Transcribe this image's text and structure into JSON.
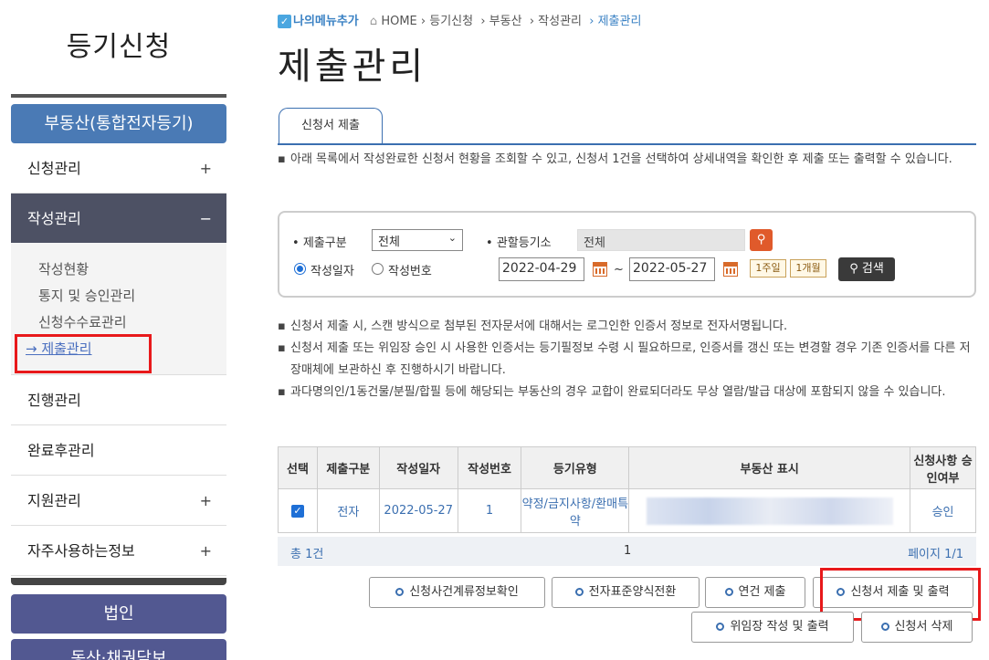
{
  "sidebar": {
    "title": "등기신청",
    "category_realestate": "부동산(통합전자등기)",
    "items": [
      {
        "label": "신청관리",
        "sign": "+"
      },
      {
        "label": "작성관리",
        "sign": "−"
      },
      {
        "label": "진행관리",
        "sign": ""
      },
      {
        "label": "완료후관리",
        "sign": ""
      },
      {
        "label": "지원관리",
        "sign": "+"
      },
      {
        "label": "자주사용하는정보",
        "sign": "+"
      }
    ],
    "submenu": [
      "작성현황",
      "통지 및 승인관리",
      "신청수수료관리",
      "→ 제출관리"
    ],
    "category_corp": "법인",
    "category_movable": "동산·채권담보"
  },
  "breadcrumb": {
    "fav_label": "나의메뉴추가",
    "home": "HOME",
    "p1": "› 등기신청",
    "p2": "› 부동산",
    "p3": "› 작성관리",
    "current": "› 제출관리"
  },
  "page_title": "제출관리",
  "tab_label": "신청서 제출",
  "notice_top": "아래 목록에서 작성완료한 신청서 현황을 조회할 수 있고, 신청서 1건을 선택하여 상세내역을 확인한 후 제출 또는 출력할 수 있습니다.",
  "search": {
    "type_label": "제출구분",
    "type_value": "전체",
    "registry_label": "관할등기소",
    "registry_value": "전체",
    "radio_date": "작성일자",
    "radio_number": "작성번호",
    "date_from": "2022-04-29",
    "date_to": "2022-05-27",
    "tilde": "~",
    "week_btn": "1주일",
    "month_btn": "1개월",
    "search_btn": "검색"
  },
  "notices": [
    "신청서 제출 시, 스캔 방식으로 첨부된 전자문서에 대해서는 로그인한 인증서 정보로 전자서명됩니다.",
    "신청서 제출 또는 위임장 승인 시 사용한 인증서는 등기필정보 수령 시 필요하므로, 인증서를 갱신 또는 변경할 경우 기존 인증서를 다른 저장매체에 보관하신 후 진행하시기 바랍니다.",
    "과다명의인/1동건물/분필/합필 등에 해당되는 부동산의 경우 교합이 완료되더라도 무상 열람/발급 대상에 포함되지 않을 수 있습니다."
  ],
  "table": {
    "headers": [
      "선택",
      "제출구분",
      "작성일자",
      "작성번호",
      "등기유형",
      "부동산 표시",
      "신청사항 승인여부"
    ],
    "rows": [
      {
        "type": "전자",
        "date": "2022-05-27",
        "number": "1",
        "reg_type": "약정/금지사항/환매특약",
        "approval": "승인"
      }
    ]
  },
  "summary": {
    "total": "총 1건",
    "page": "1",
    "page_info": "페이지 1/1"
  },
  "actions": {
    "btn1": "신청사건계류정보확인",
    "btn2": "전자표준양식전환",
    "btn3": "연건 제출",
    "btn4": "신청서 제출 및 출력",
    "btn5": "위임장 작성 및 출력",
    "btn6": "신청서 삭제"
  },
  "colors": {
    "accent": "#3b6fb0",
    "highlight": "#e8191b",
    "active_menu": "#4d5164"
  }
}
